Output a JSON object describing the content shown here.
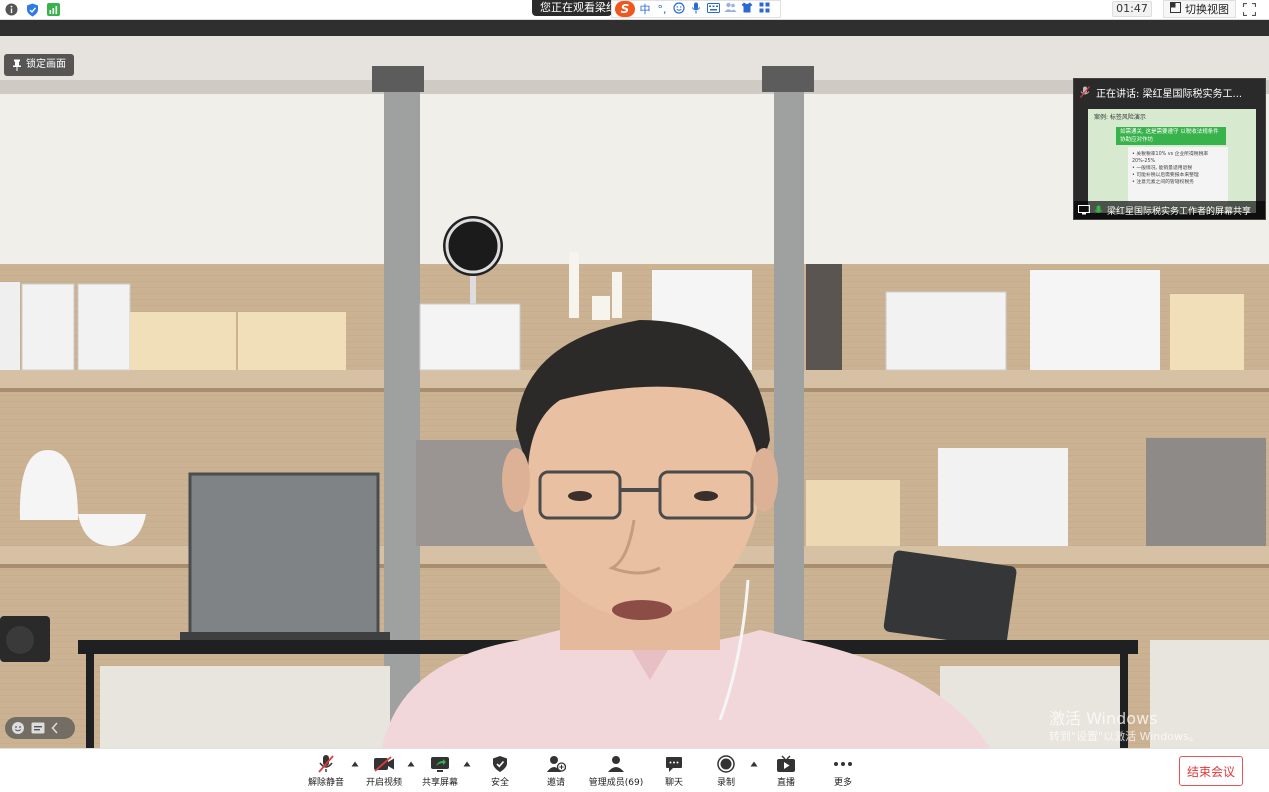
{
  "topbar": {
    "watching_text": "您正在观看梁红星",
    "timer": "01:47",
    "switch_view_label": "切换视图"
  },
  "ime": {
    "items": [
      "中",
      "°,",
      "☺",
      "🎤",
      "⌨",
      "👥",
      "👕",
      "▦"
    ]
  },
  "video": {
    "pin_label": "锁定画面"
  },
  "speaker": {
    "label": "正在讲话: 梁红星国际税实务工...",
    "share_footer": "梁红星国际税实务工作者的屏幕共享",
    "preview": {
      "title": "案例: 标签风险演示",
      "green_text": "如需通关, 这是需要遵守 以税收法规条件协助应对作坊",
      "lines": [
        "• 关税税率10% vs 企业所得税税率",
        "  20%-25%",
        "• 一般情况, 能销量适用退税",
        "• 可能补税以后需要报本来整理",
        "• 注意元素之间的管辖权税务"
      ]
    }
  },
  "watermark": {
    "line1": "激活 Windows",
    "line2": "转到\"设置\"以激活 Windows。"
  },
  "toolbar": {
    "unmute": "解除静音",
    "start_video": "开启视频",
    "share_screen": "共享屏幕",
    "security": "安全",
    "invite": "邀请",
    "manage_members": "管理成员(69)",
    "chat": "聊天",
    "record": "录制",
    "live": "直播",
    "more": "更多",
    "end_meeting": "结束会议"
  },
  "colors": {
    "accent_green": "#38b24a",
    "end_red": "#e2363a",
    "muted_red": "#e23b3b"
  }
}
